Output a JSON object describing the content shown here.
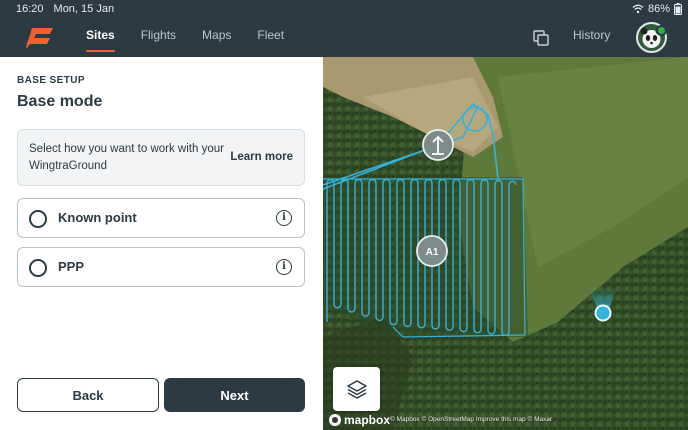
{
  "status_bar": {
    "time": "16:20",
    "date": "Mon, 15 Jan",
    "battery": "86%",
    "icons": [
      "wifi-icon",
      "battery-icon"
    ]
  },
  "nav": {
    "tabs": [
      {
        "label": "Sites",
        "active": true
      },
      {
        "label": "Flights",
        "active": false
      },
      {
        "label": "Maps",
        "active": false
      },
      {
        "label": "Fleet",
        "active": false
      }
    ],
    "history_label": "History",
    "accent": "#f2622e",
    "bar_color": "#2c3a43",
    "online_color": "#2bb34a"
  },
  "panel": {
    "section_label": "BASE SETUP",
    "title": "Base mode",
    "info_text": "Select how you want to work with your WingtraGround",
    "learn_more": "Learn more",
    "options": [
      {
        "label": "Known point",
        "selected": false
      },
      {
        "label": "PPP",
        "selected": false
      }
    ],
    "back_label": "Back",
    "next_label": "Next"
  },
  "map": {
    "area_label": "A1",
    "mapbox_label": "mapbox",
    "attribution": "© Mapbox © OpenStreetMap Improve this map © Maxar",
    "route_color": "#33b3dc",
    "icons": [
      "takeoff-arrow-icon",
      "drone-location-icon",
      "layers-icon"
    ]
  }
}
